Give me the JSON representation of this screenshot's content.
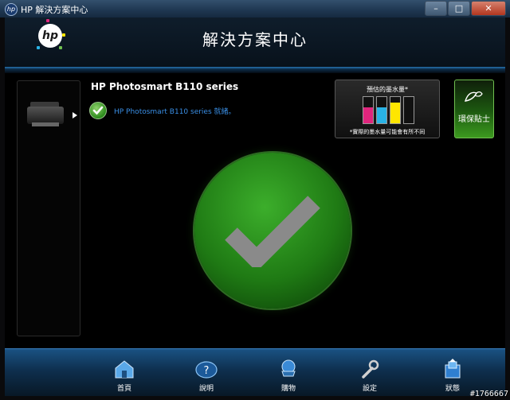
{
  "window": {
    "title": "HP 解決方案中心",
    "minimize": "–",
    "maximize": "□",
    "close": "✕"
  },
  "header": {
    "logo_text": "hp",
    "title": "解決方案中心"
  },
  "device": {
    "name": "HP Photosmart B110 series",
    "status": "HP Photosmart B110 series 就緒。"
  },
  "ink": {
    "title": "預估的墨水量*",
    "note": "*實際的墨水量可能會有所不同",
    "cartridges": [
      {
        "color": "#e0257d",
        "level": 0.6
      },
      {
        "color": "#29b3e6",
        "level": 0.62
      },
      {
        "color": "#ffe600",
        "level": 0.78
      },
      {
        "color": "#111111",
        "level": 0.05
      }
    ]
  },
  "eco": {
    "label": "環保貼士"
  },
  "nav": {
    "items": [
      {
        "label": "首頁",
        "icon": "home-icon"
      },
      {
        "label": "說明",
        "icon": "help-icon"
      },
      {
        "label": "購物",
        "icon": "shopping-cart-icon"
      },
      {
        "label": "設定",
        "icon": "wrench-icon"
      },
      {
        "label": "狀態",
        "icon": "status-icon"
      }
    ]
  },
  "watermark": "#1766667"
}
